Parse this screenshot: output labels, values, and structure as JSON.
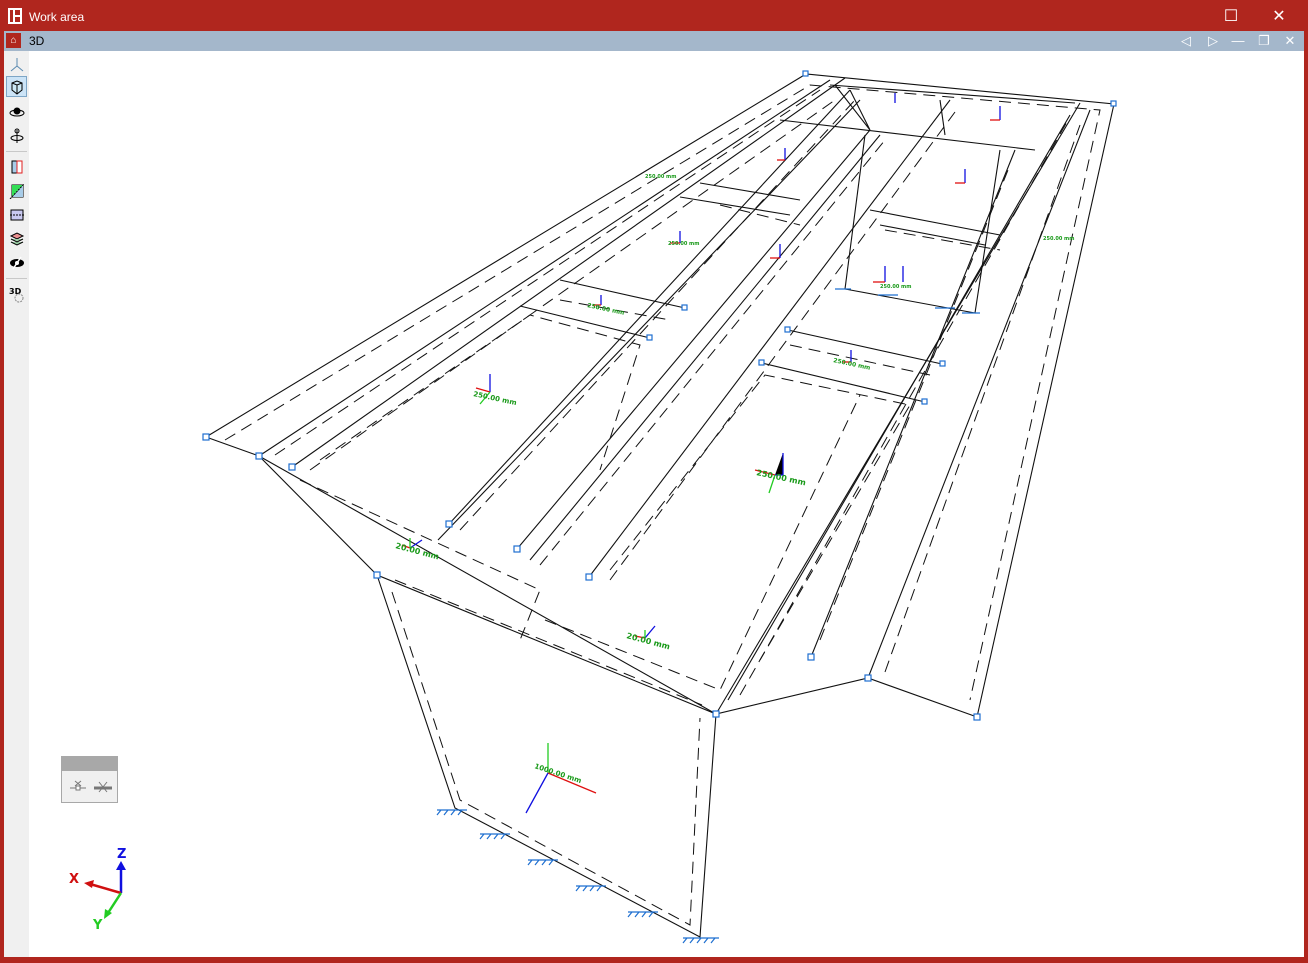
{
  "window": {
    "title": "Work area",
    "maximize_icon": "maximize-icon",
    "close_icon": "close-icon"
  },
  "document": {
    "title": "3D",
    "buttons": [
      "prev-icon",
      "next-icon",
      "minimize-icon",
      "restore-icon",
      "close-icon"
    ]
  },
  "toolbar": {
    "tools": [
      "axes-icon",
      "view-cube-icon",
      "orbit-icon",
      "rotate-axis-icon",
      "section-x-icon",
      "section-diagonal-icon",
      "section-horizontal-icon",
      "layers-icon",
      "hide-icon",
      "3d-settings-icon"
    ]
  },
  "model": {
    "thickness_labels": [
      "250.00 mm",
      "250.00 mm",
      "250.00 mm",
      "250.00 mm",
      "20.00 mm",
      "20.00 mm",
      "1000.00 mm",
      "250.00 mm",
      "250.00 mm",
      "250.00 mm",
      "250.00 mm"
    ]
  },
  "axes": {
    "x": "X",
    "y": "Y",
    "z": "Z",
    "x_color": "#e01010",
    "y_color": "#22cc22",
    "z_color": "#1010e0"
  },
  "colors": {
    "frame": "#b0261e",
    "docbar": "#a4b7cb",
    "node": "#1e6fd0",
    "label": "#1a9a1a"
  }
}
